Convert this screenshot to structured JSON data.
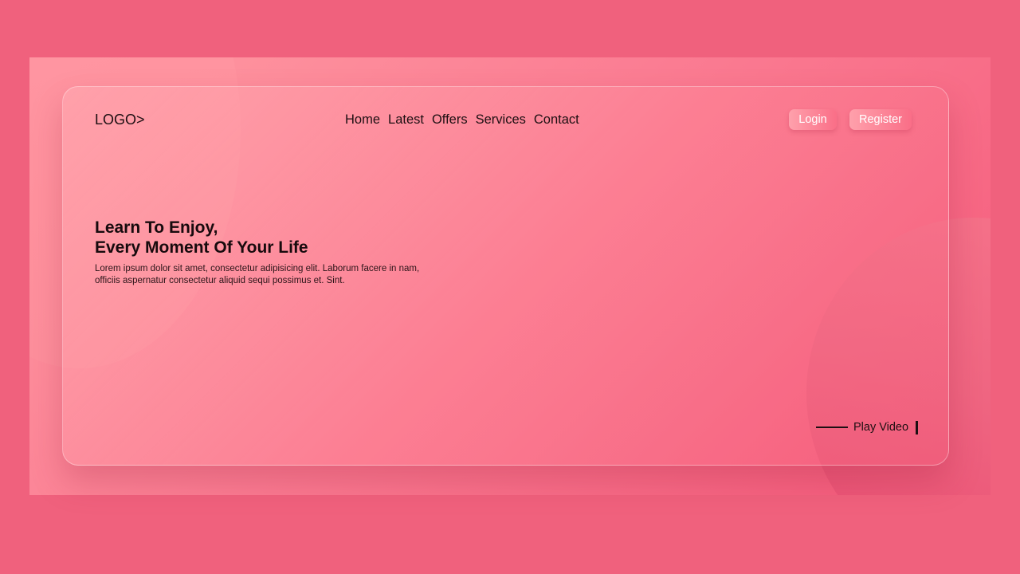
{
  "header": {
    "logo": "LOGO>",
    "nav": [
      "Home",
      "Latest",
      "Offers",
      "Services",
      "Contact"
    ],
    "login_label": "Login",
    "register_label": "Register"
  },
  "hero": {
    "title_line1": "Learn To Enjoy,",
    "title_line2": "Every Moment Of Your Life",
    "desc_line1": "Lorem ipsum dolor sit amet, consectetur adipisicing elit. Laborum facere in nam,",
    "desc_line2": "officiis aspernatur consectetur aliquid sequi possimus et. Sint."
  },
  "play": {
    "label": "Play Video"
  },
  "colors": {
    "page_background": "#f0617d",
    "accent_pink": "#ff9aa2",
    "accent_deep": "#e94e72",
    "text_dark": "#1d0f12"
  }
}
